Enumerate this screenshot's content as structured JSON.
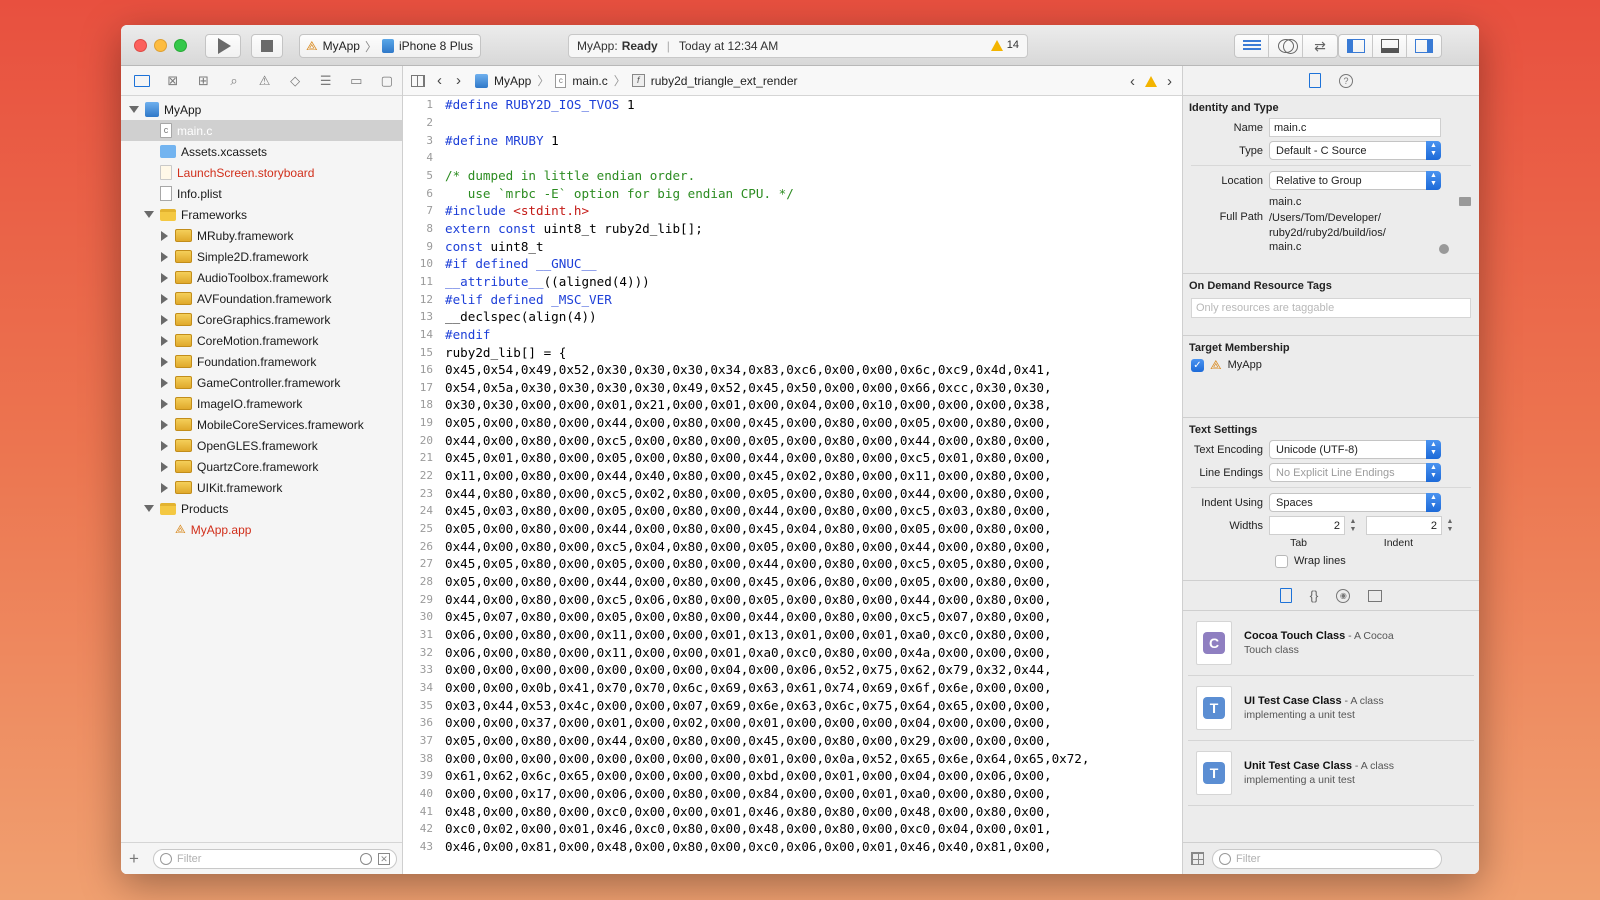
{
  "toolbar": {
    "scheme_app": "MyApp",
    "scheme_device": "iPhone 8 Plus",
    "status_app": "MyApp:",
    "status_state": "Ready",
    "status_time": "Today at 12:34 AM",
    "warning_count": "14"
  },
  "navigator": {
    "items": [
      {
        "label": "MyApp",
        "indent": 0,
        "disclosure": "open",
        "icon": "project-icon",
        "color": "normal"
      },
      {
        "label": "main.c",
        "indent": 1,
        "disclosure": "none",
        "icon": "c-file-icon",
        "color": "selected"
      },
      {
        "label": "Assets.xcassets",
        "indent": 1,
        "disclosure": "none",
        "icon": "assets-icon",
        "color": "normal"
      },
      {
        "label": "LaunchScreen.storyboard",
        "indent": 1,
        "disclosure": "none",
        "icon": "storyboard-icon",
        "color": "red"
      },
      {
        "label": "Info.plist",
        "indent": 1,
        "disclosure": "none",
        "icon": "plist-icon",
        "color": "normal"
      },
      {
        "label": "Frameworks",
        "indent": 1,
        "disclosure": "open",
        "icon": "folder-icon",
        "color": "normal"
      },
      {
        "label": "MRuby.framework",
        "indent": 2,
        "disclosure": "closed",
        "icon": "framework-icon",
        "color": "normal"
      },
      {
        "label": "Simple2D.framework",
        "indent": 2,
        "disclosure": "closed",
        "icon": "framework-icon",
        "color": "normal"
      },
      {
        "label": "AudioToolbox.framework",
        "indent": 2,
        "disclosure": "closed",
        "icon": "framework-icon",
        "color": "normal"
      },
      {
        "label": "AVFoundation.framework",
        "indent": 2,
        "disclosure": "closed",
        "icon": "framework-icon",
        "color": "normal"
      },
      {
        "label": "CoreGraphics.framework",
        "indent": 2,
        "disclosure": "closed",
        "icon": "framework-icon",
        "color": "normal"
      },
      {
        "label": "CoreMotion.framework",
        "indent": 2,
        "disclosure": "closed",
        "icon": "framework-icon",
        "color": "normal"
      },
      {
        "label": "Foundation.framework",
        "indent": 2,
        "disclosure": "closed",
        "icon": "framework-icon",
        "color": "normal"
      },
      {
        "label": "GameController.framework",
        "indent": 2,
        "disclosure": "closed",
        "icon": "framework-icon",
        "color": "normal"
      },
      {
        "label": "ImageIO.framework",
        "indent": 2,
        "disclosure": "closed",
        "icon": "framework-icon",
        "color": "normal"
      },
      {
        "label": "MobileCoreServices.framework",
        "indent": 2,
        "disclosure": "closed",
        "icon": "framework-icon",
        "color": "normal"
      },
      {
        "label": "OpenGLES.framework",
        "indent": 2,
        "disclosure": "closed",
        "icon": "framework-icon",
        "color": "normal"
      },
      {
        "label": "QuartzCore.framework",
        "indent": 2,
        "disclosure": "closed",
        "icon": "framework-icon",
        "color": "normal"
      },
      {
        "label": "UIKit.framework",
        "indent": 2,
        "disclosure": "closed",
        "icon": "framework-icon",
        "color": "normal"
      },
      {
        "label": "Products",
        "indent": 1,
        "disclosure": "open",
        "icon": "folder-icon",
        "color": "normal"
      },
      {
        "label": "MyApp.app",
        "indent": 2,
        "disclosure": "none",
        "icon": "app-icon",
        "color": "red"
      }
    ],
    "filter_placeholder": "Filter"
  },
  "jumpbar": {
    "project": "MyApp",
    "file": "main.c",
    "symbol": "ruby2d_triangle_ext_render"
  },
  "code_lines": [
    [
      [
        "pp",
        "#define RUBY2D_IOS_TVOS"
      ],
      [
        "t",
        " 1"
      ]
    ],
    [],
    [
      [
        "pp",
        "#define MRUBY"
      ],
      [
        "t",
        " 1"
      ]
    ],
    [],
    [
      [
        "cm",
        "/* dumped in little endian order."
      ]
    ],
    [
      [
        "cm",
        "   use `mrbc -E` option for big endian CPU. */"
      ]
    ],
    [
      [
        "pp",
        "#include "
      ],
      [
        "str",
        "<stdint.h>"
      ]
    ],
    [
      [
        "kw",
        "extern const"
      ],
      [
        "t",
        " uint8_t ruby2d_lib[];"
      ]
    ],
    [
      [
        "kw",
        "const"
      ],
      [
        "t",
        " uint8_t"
      ]
    ],
    [
      [
        "pp",
        "#if defined __GNUC__"
      ]
    ],
    [
      [
        "pp",
        "__attribute__"
      ],
      [
        "t",
        "((aligned(4)))"
      ]
    ],
    [
      [
        "pp",
        "#elif defined _MSC_VER"
      ]
    ],
    [
      [
        "t",
        "__declspec(align(4))"
      ]
    ],
    [
      [
        "pp",
        "#endif"
      ]
    ],
    [
      [
        "t",
        "ruby2d_lib[] = {"
      ]
    ],
    [
      [
        "t",
        "0x45,0x54,0x49,0x52,0x30,0x30,0x30,0x34,0x83,0xc6,0x00,0x00,0x6c,0xc9,0x4d,0x41,"
      ]
    ],
    [
      [
        "t",
        "0x54,0x5a,0x30,0x30,0x30,0x30,0x49,0x52,0x45,0x50,0x00,0x00,0x66,0xcc,0x30,0x30,"
      ]
    ],
    [
      [
        "t",
        "0x30,0x30,0x00,0x00,0x01,0x21,0x00,0x01,0x00,0x04,0x00,0x10,0x00,0x00,0x00,0x38,"
      ]
    ],
    [
      [
        "t",
        "0x05,0x00,0x80,0x00,0x44,0x00,0x80,0x00,0x45,0x00,0x80,0x00,0x05,0x00,0x80,0x00,"
      ]
    ],
    [
      [
        "t",
        "0x44,0x00,0x80,0x00,0xc5,0x00,0x80,0x00,0x05,0x00,0x80,0x00,0x44,0x00,0x80,0x00,"
      ]
    ],
    [
      [
        "t",
        "0x45,0x01,0x80,0x00,0x05,0x00,0x80,0x00,0x44,0x00,0x80,0x00,0xc5,0x01,0x80,0x00,"
      ]
    ],
    [
      [
        "t",
        "0x11,0x00,0x80,0x00,0x44,0x40,0x80,0x00,0x45,0x02,0x80,0x00,0x11,0x00,0x80,0x00,"
      ]
    ],
    [
      [
        "t",
        "0x44,0x80,0x80,0x00,0xc5,0x02,0x80,0x00,0x05,0x00,0x80,0x00,0x44,0x00,0x80,0x00,"
      ]
    ],
    [
      [
        "t",
        "0x45,0x03,0x80,0x00,0x05,0x00,0x80,0x00,0x44,0x00,0x80,0x00,0xc5,0x03,0x80,0x00,"
      ]
    ],
    [
      [
        "t",
        "0x05,0x00,0x80,0x00,0x44,0x00,0x80,0x00,0x45,0x04,0x80,0x00,0x05,0x00,0x80,0x00,"
      ]
    ],
    [
      [
        "t",
        "0x44,0x00,0x80,0x00,0xc5,0x04,0x80,0x00,0x05,0x00,0x80,0x00,0x44,0x00,0x80,0x00,"
      ]
    ],
    [
      [
        "t",
        "0x45,0x05,0x80,0x00,0x05,0x00,0x80,0x00,0x44,0x00,0x80,0x00,0xc5,0x05,0x80,0x00,"
      ]
    ],
    [
      [
        "t",
        "0x05,0x00,0x80,0x00,0x44,0x00,0x80,0x00,0x45,0x06,0x80,0x00,0x05,0x00,0x80,0x00,"
      ]
    ],
    [
      [
        "t",
        "0x44,0x00,0x80,0x00,0xc5,0x06,0x80,0x00,0x05,0x00,0x80,0x00,0x44,0x00,0x80,0x00,"
      ]
    ],
    [
      [
        "t",
        "0x45,0x07,0x80,0x00,0x05,0x00,0x80,0x00,0x44,0x00,0x80,0x00,0xc5,0x07,0x80,0x00,"
      ]
    ],
    [
      [
        "t",
        "0x06,0x00,0x80,0x00,0x11,0x00,0x00,0x01,0x13,0x01,0x00,0x01,0xa0,0xc0,0x80,0x00,"
      ]
    ],
    [
      [
        "t",
        "0x06,0x00,0x80,0x00,0x11,0x00,0x00,0x01,0xa0,0xc0,0x80,0x00,0x4a,0x00,0x00,0x00,"
      ]
    ],
    [
      [
        "t",
        "0x00,0x00,0x00,0x00,0x00,0x00,0x00,0x04,0x00,0x06,0x52,0x75,0x62,0x79,0x32,0x44,"
      ]
    ],
    [
      [
        "t",
        "0x00,0x00,0x0b,0x41,0x70,0x70,0x6c,0x69,0x63,0x61,0x74,0x69,0x6f,0x6e,0x00,0x00,"
      ]
    ],
    [
      [
        "t",
        "0x03,0x44,0x53,0x4c,0x00,0x00,0x07,0x69,0x6e,0x63,0x6c,0x75,0x64,0x65,0x00,0x00,"
      ]
    ],
    [
      [
        "t",
        "0x00,0x00,0x37,0x00,0x01,0x00,0x02,0x00,0x01,0x00,0x00,0x00,0x04,0x00,0x00,0x00,"
      ]
    ],
    [
      [
        "t",
        "0x05,0x00,0x80,0x00,0x44,0x00,0x80,0x00,0x45,0x00,0x80,0x00,0x29,0x00,0x00,0x00,"
      ]
    ],
    [
      [
        "t",
        "0x00,0x00,0x00,0x00,0x00,0x00,0x00,0x00,0x01,0x00,0x0a,0x52,0x65,0x6e,0x64,0x65,0x72,"
      ]
    ],
    [
      [
        "t",
        "0x61,0x62,0x6c,0x65,0x00,0x00,0x00,0x00,0xbd,0x00,0x01,0x00,0x04,0x00,0x06,0x00,"
      ]
    ],
    [
      [
        "t",
        "0x00,0x00,0x17,0x00,0x06,0x00,0x80,0x00,0x84,0x00,0x00,0x01,0xa0,0x00,0x80,0x00,"
      ]
    ],
    [
      [
        "t",
        "0x48,0x00,0x80,0x00,0xc0,0x00,0x00,0x01,0x46,0x80,0x80,0x00,0x48,0x00,0x80,0x00,"
      ]
    ],
    [
      [
        "t",
        "0xc0,0x02,0x00,0x01,0x46,0xc0,0x80,0x00,0x48,0x00,0x80,0x00,0xc0,0x04,0x00,0x01,"
      ]
    ],
    [
      [
        "t",
        "0x46,0x00,0x81,0x00,0x48,0x00,0x80,0x00,0xc0,0x06,0x00,0x01,0x46,0x40,0x81,0x00,"
      ]
    ]
  ],
  "inspector": {
    "identity_title": "Identity and Type",
    "name_label": "Name",
    "name_value": "main.c",
    "type_label": "Type",
    "type_value": "Default - C Source",
    "location_label": "Location",
    "location_value": "Relative to Group",
    "location_file": "main.c",
    "fullpath_label": "Full Path",
    "fullpath_lines": [
      "/Users/Tom/Developer/",
      "ruby2d/ruby2d/build/ios/",
      "main.c"
    ],
    "ondemand_title": "On Demand Resource Tags",
    "tags_placeholder": "Only resources are taggable",
    "target_title": "Target Membership",
    "target_name": "MyApp",
    "text_title": "Text Settings",
    "encoding_label": "Text Encoding",
    "encoding_value": "Unicode (UTF-8)",
    "endings_label": "Line Endings",
    "endings_value": "No Explicit Line Endings",
    "indent_label": "Indent Using",
    "indent_value": "Spaces",
    "widths_label": "Widths",
    "tab_width": "2",
    "indent_width": "2",
    "tab_caption": "Tab",
    "indent_caption": "Indent",
    "wrap_label": "Wrap lines",
    "library": [
      {
        "badge": "C",
        "kind": "c",
        "title": "Cocoa Touch Class",
        "desc1": " - A Cocoa",
        "desc2": "Touch class"
      },
      {
        "badge": "T",
        "kind": "t",
        "title": "UI Test Case Class",
        "desc1": " - A class",
        "desc2": "implementing a unit test"
      },
      {
        "badge": "T",
        "kind": "t",
        "title": "Unit Test Case Class",
        "desc1": " - A class",
        "desc2": "implementing a unit test"
      }
    ],
    "filter_placeholder": "Filter"
  }
}
